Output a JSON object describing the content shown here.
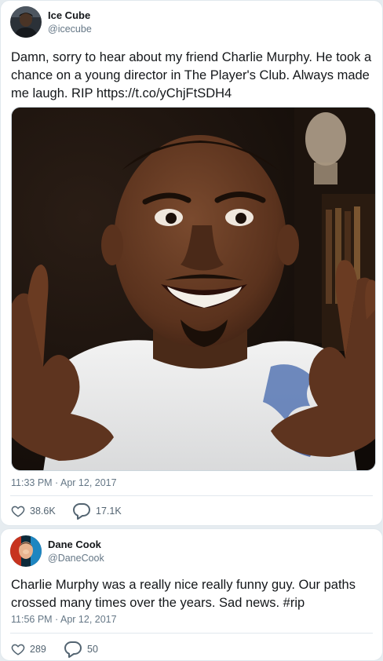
{
  "tweets": [
    {
      "author": {
        "name": "Ice Cube",
        "handle": "@icecube",
        "avatar_icon": "portrait-avatar-dark"
      },
      "text": "Damn, sorry to hear about my friend Charlie Murphy. He took a chance on a young director in The Player's Club. Always made me laugh. RIP https://t.co/yChjFtSDH4",
      "media": {
        "type": "photo",
        "description_icon": "smiling-man-photo"
      },
      "timestamp": "11:33 PM · Apr 12, 2017",
      "likes": "38.6K",
      "replies": "17.1K"
    },
    {
      "author": {
        "name": "Dane Cook",
        "handle": "@DaneCook",
        "avatar_icon": "portrait-avatar-red"
      },
      "text": "Charlie Murphy was a really nice really funny guy. Our paths crossed many times over the years. Sad news. #rip",
      "timestamp": "11:56 PM · Apr 12, 2017",
      "likes": "289",
      "replies": "50"
    }
  ],
  "colors": {
    "background": "#e6ecf0",
    "card": "#ffffff",
    "text": "#14171a",
    "secondary": "#657786",
    "border": "#e1e8ed"
  }
}
